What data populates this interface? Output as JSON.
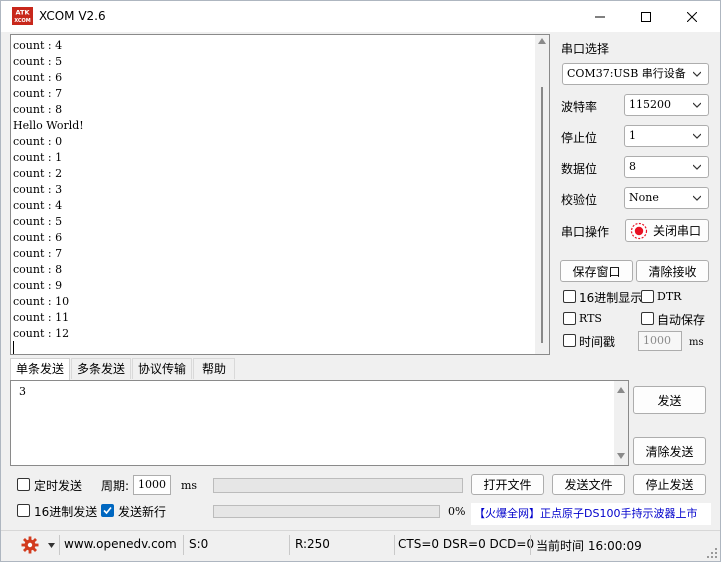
{
  "window": {
    "title": "XCOM V2.6",
    "icon_text": "ATK\nXCOM"
  },
  "receive": {
    "lines": [
      "count : 4",
      "count : 5",
      "count : 6",
      "count : 7",
      "count : 8",
      "Hello World!",
      "count : 0",
      "count : 1",
      "count : 2",
      "count : 3",
      "count : 4",
      "count : 5",
      "count : 6",
      "count : 7",
      "count : 8",
      "count : 9",
      "count : 10",
      "count : 11",
      "count : 12"
    ]
  },
  "serial_settings": {
    "port_select_label": "串口选择",
    "port_value": "COM37:USB 串行设备",
    "baud_label": "波特率",
    "baud_value": "115200",
    "stop_label": "停止位",
    "stop_value": "1",
    "data_label": "数据位",
    "data_value": "8",
    "parity_label": "校验位",
    "parity_value": "None",
    "op_label": "串口操作",
    "op_button": "关闭串口"
  },
  "receive_options": {
    "save_window": "保存窗口",
    "clear_receive": "清除接收",
    "hex_display": "16进制显示",
    "dtr": "DTR",
    "rts": "RTS",
    "auto_save": "自动保存",
    "timestamp": "时间戳",
    "timestamp_ms_value": "1000",
    "timestamp_ms_unit": "ms"
  },
  "tabs": [
    {
      "label": "单条发送"
    },
    {
      "label": "多条发送"
    },
    {
      "label": "协议传输"
    },
    {
      "label": "帮助"
    }
  ],
  "send": {
    "text": "3",
    "send_button": "发送",
    "clear_send_button": "清除发送"
  },
  "bottom": {
    "timed_send": "定时发送",
    "period_label": "周期:",
    "period_value": "1000",
    "period_unit": "ms",
    "hex_send": "16进制发送",
    "send_newline": "发送新行",
    "open_file": "打开文件",
    "send_file": "发送文件",
    "stop_send": "停止发送",
    "progress_text": "0%",
    "progress_value": 0,
    "ad_text": "【火爆全网】正点原子DS100手持示波器上市"
  },
  "status": {
    "url": "www.openedv.com",
    "sent": "S:0",
    "received": "R:250",
    "signals": "CTS=0 DSR=0 DCD=0",
    "time": "当前时间 16:00:09"
  },
  "colors": {
    "accent": "#0067c0",
    "gear": "#d23b1e",
    "close_port_icon": "#e81123"
  }
}
